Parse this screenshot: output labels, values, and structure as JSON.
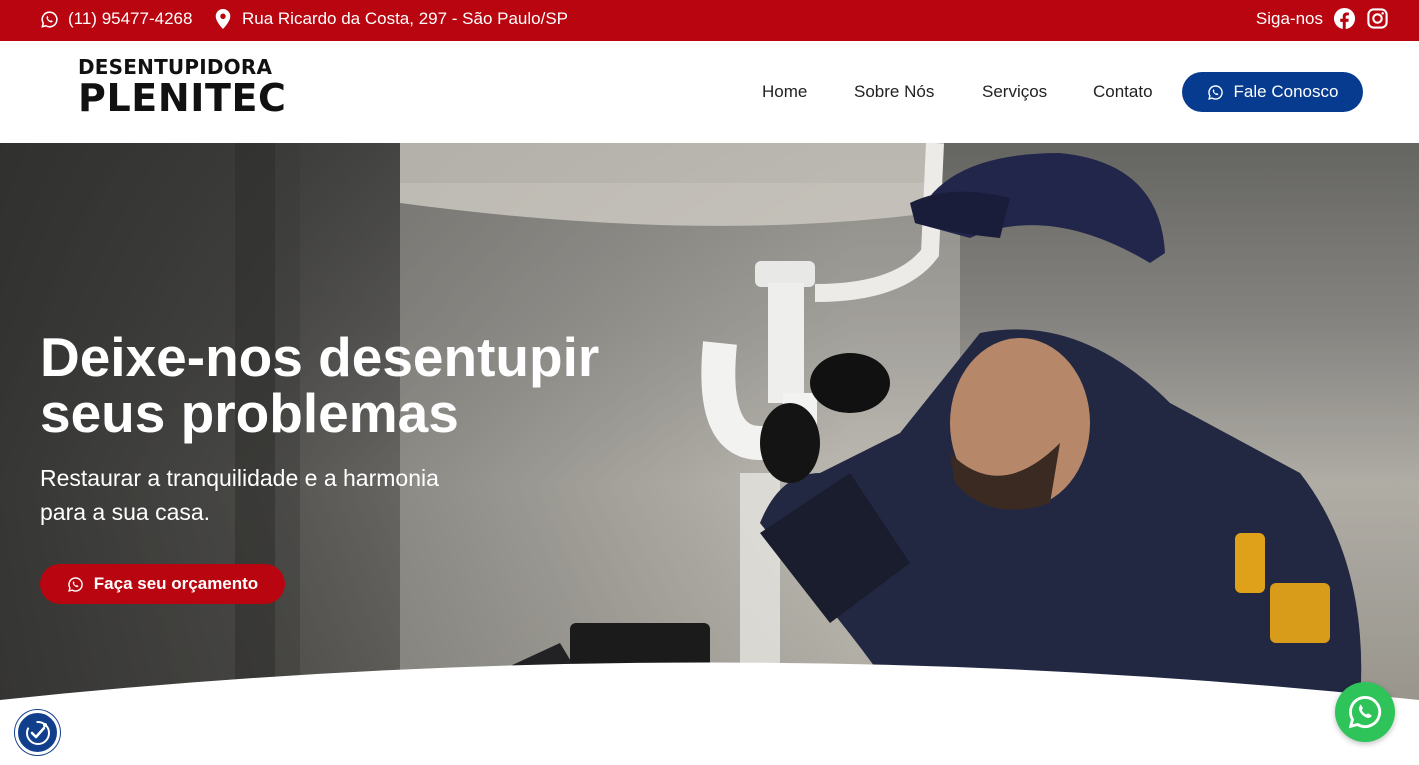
{
  "topbar": {
    "phone": "(11) 95477-4268",
    "address": "Rua Ricardo da Costa, 297 - São Paulo/SP",
    "follow_label": "Siga-nos",
    "icons": [
      "whatsapp-icon",
      "map-pin-icon",
      "facebook-icon",
      "instagram-icon"
    ]
  },
  "header": {
    "logo_line1": "DESENTUPIDORA",
    "logo_line2": "PLENITEC",
    "nav": [
      "Home",
      "Sobre Nós",
      "Serviços",
      "Contato"
    ],
    "cta_label": "Fale Conosco"
  },
  "hero": {
    "title_line1": "Deixe-nos desentupir",
    "title_line2": "seus problemas",
    "subtitle_line1": "Restaurar a tranquilidade e a harmonia",
    "subtitle_line2": "para a sua casa.",
    "cta_label": "Faça seu orçamento"
  },
  "colors": {
    "brand_red": "#b8050f",
    "brand_blue": "#073b8f",
    "whatsapp_green": "#2ec45a"
  }
}
